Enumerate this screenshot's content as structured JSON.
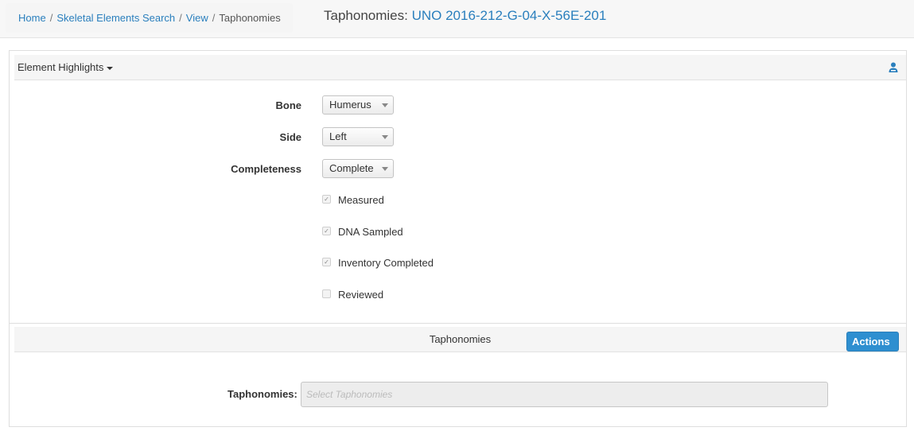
{
  "breadcrumb": {
    "home": "Home",
    "sep": "/",
    "search": "Skeletal Elements Search",
    "view": "View",
    "current": "Taphonomies"
  },
  "title": {
    "prefix": "Taphonomies:",
    "link": "UNO 2016-212-G-04-X-56E-201"
  },
  "element_highlights": {
    "title": "Element Highlights",
    "icon": "person-icon",
    "bone": {
      "label": "Bone",
      "value": "Humerus"
    },
    "side": {
      "label": "Side",
      "value": "Left"
    },
    "completeness": {
      "label": "Completeness",
      "value": "Complete"
    },
    "checks": [
      {
        "label": "Measured",
        "checked": true
      },
      {
        "label": "DNA Sampled",
        "checked": true
      },
      {
        "label": "Inventory Completed",
        "checked": true
      },
      {
        "label": "Reviewed",
        "checked": false
      }
    ]
  },
  "taphonomies": {
    "title": "Taphonomies",
    "actions_label": "Actions",
    "field_label": "Taphonomies:",
    "placeholder": "Select Taphonomies"
  },
  "colors": {
    "link": "#2a7fbd",
    "actions_button": "#2e8fd0"
  }
}
